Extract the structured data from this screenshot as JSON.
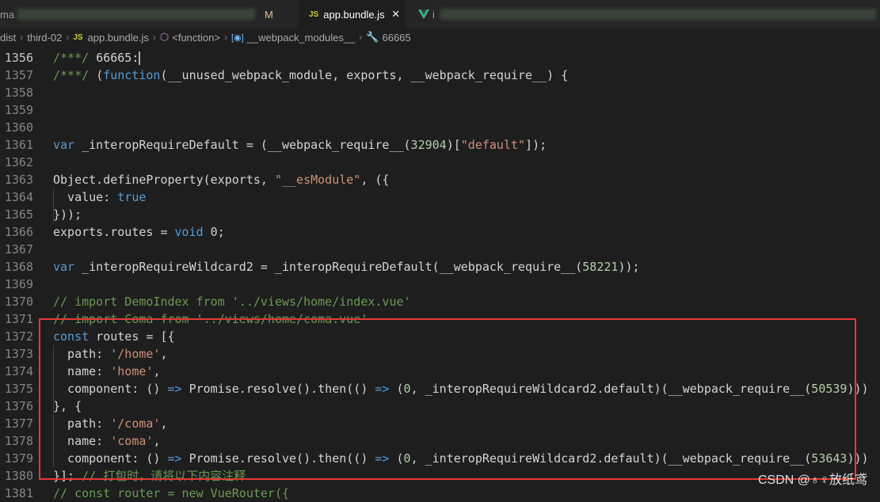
{
  "tabs": [
    {
      "label": "ma",
      "status": "M",
      "active": false
    },
    {
      "label": "app.bundle.js",
      "icon": "JS",
      "active": true,
      "close": "×"
    },
    {
      "label": "i",
      "icon": "vue-icon",
      "active": false
    }
  ],
  "breadcrumb": [
    "dist",
    "third-02",
    "app.bundle.js",
    "<function>",
    "__webpack_modules__",
    "66665"
  ],
  "lines": [
    {
      "n": "1356",
      "tokens": [
        {
          "t": "/***/ ",
          "c": "cm"
        },
        {
          "t": "66665:",
          "c": "pl"
        }
      ]
    },
    {
      "n": "1357",
      "tokens": [
        {
          "t": "/***/ ",
          "c": "cm"
        },
        {
          "t": "(",
          "c": "pl"
        },
        {
          "t": "function",
          "c": "kw"
        },
        {
          "t": "(__unused_webpack_module, exports, __webpack_require__) {",
          "c": "pl"
        }
      ]
    },
    {
      "n": "1358",
      "tokens": []
    },
    {
      "n": "1359",
      "tokens": []
    },
    {
      "n": "1360",
      "tokens": []
    },
    {
      "n": "1361",
      "tokens": [
        {
          "t": "var",
          "c": "kw"
        },
        {
          "t": " _interopRequireDefault = (__webpack_require__(",
          "c": "pl"
        },
        {
          "t": "32904",
          "c": "num"
        },
        {
          "t": ")[",
          "c": "pl"
        },
        {
          "t": "\"default\"",
          "c": "str"
        },
        {
          "t": "]);",
          "c": "pl"
        }
      ]
    },
    {
      "n": "1362",
      "tokens": []
    },
    {
      "n": "1363",
      "tokens": [
        {
          "t": "Object.defineProperty(exports, ",
          "c": "pl"
        },
        {
          "t": "\"__esModule\"",
          "c": "str"
        },
        {
          "t": ", ({",
          "c": "pl"
        }
      ]
    },
    {
      "n": "1364",
      "tokens": [
        {
          "t": "  value: ",
          "c": "pl"
        },
        {
          "t": "true",
          "c": "kw"
        }
      ]
    },
    {
      "n": "1365",
      "tokens": [
        {
          "t": "}));",
          "c": "pl"
        }
      ]
    },
    {
      "n": "1366",
      "tokens": [
        {
          "t": "exports.routes = ",
          "c": "pl"
        },
        {
          "t": "void",
          "c": "kw"
        },
        {
          "t": " 0;",
          "c": "pl"
        }
      ]
    },
    {
      "n": "1367",
      "tokens": []
    },
    {
      "n": "1368",
      "tokens": [
        {
          "t": "var",
          "c": "kw"
        },
        {
          "t": " _interopRequireWildcard2 = _interopRequireDefault(__webpack_require__(",
          "c": "pl"
        },
        {
          "t": "58221",
          "c": "num"
        },
        {
          "t": "));",
          "c": "pl"
        }
      ]
    },
    {
      "n": "1369",
      "tokens": []
    },
    {
      "n": "1370",
      "tokens": [
        {
          "t": "// import DemoIndex from '../views/home/index.vue'",
          "c": "cm"
        }
      ]
    },
    {
      "n": "1371",
      "tokens": [
        {
          "t": "// import Coma from '../views/home/coma.vue'",
          "c": "cm"
        }
      ]
    },
    {
      "n": "1372",
      "tokens": [
        {
          "t": "const",
          "c": "kw"
        },
        {
          "t": " routes = [{",
          "c": "pl"
        }
      ]
    },
    {
      "n": "1373",
      "tokens": [
        {
          "t": "  path: ",
          "c": "pl"
        },
        {
          "t": "'/home'",
          "c": "str"
        },
        {
          "t": ",",
          "c": "pl"
        }
      ]
    },
    {
      "n": "1374",
      "tokens": [
        {
          "t": "  name: ",
          "c": "pl"
        },
        {
          "t": "'home'",
          "c": "str"
        },
        {
          "t": ",",
          "c": "pl"
        }
      ]
    },
    {
      "n": "1375",
      "tokens": [
        {
          "t": "  component: () ",
          "c": "pl"
        },
        {
          "t": "=>",
          "c": "kw"
        },
        {
          "t": " Promise.resolve().then(() ",
          "c": "pl"
        },
        {
          "t": "=>",
          "c": "kw"
        },
        {
          "t": " (",
          "c": "pl"
        },
        {
          "t": "0",
          "c": "num"
        },
        {
          "t": ", _interopRequireWildcard2.default)(__webpack_require__(",
          "c": "pl"
        },
        {
          "t": "50539",
          "c": "num"
        },
        {
          "t": ")))",
          "c": "pl"
        }
      ]
    },
    {
      "n": "1376",
      "tokens": [
        {
          "t": "}, {",
          "c": "pl"
        }
      ]
    },
    {
      "n": "1377",
      "tokens": [
        {
          "t": "  path: ",
          "c": "pl"
        },
        {
          "t": "'/coma'",
          "c": "str"
        },
        {
          "t": ",",
          "c": "pl"
        }
      ]
    },
    {
      "n": "1378",
      "tokens": [
        {
          "t": "  name: ",
          "c": "pl"
        },
        {
          "t": "'coma'",
          "c": "str"
        },
        {
          "t": ",",
          "c": "pl"
        }
      ]
    },
    {
      "n": "1379",
      "tokens": [
        {
          "t": "  component: () ",
          "c": "pl"
        },
        {
          "t": "=>",
          "c": "kw"
        },
        {
          "t": " Promise.resolve().then(() ",
          "c": "pl"
        },
        {
          "t": "=>",
          "c": "kw"
        },
        {
          "t": " (",
          "c": "pl"
        },
        {
          "t": "0",
          "c": "num"
        },
        {
          "t": ", _interopRequireWildcard2.default)(__webpack_require__(",
          "c": "pl"
        },
        {
          "t": "53643",
          "c": "num"
        },
        {
          "t": ")))",
          "c": "pl"
        }
      ]
    },
    {
      "n": "1380",
      "tokens": [
        {
          "t": "}]; ",
          "c": "pl"
        },
        {
          "t": "// 打包时，请将以下内容注释",
          "c": "cm"
        }
      ]
    },
    {
      "n": "1381",
      "tokens": [
        {
          "t": "// const router = new VueRouter({",
          "c": "cm"
        }
      ]
    }
  ],
  "watermark": "CSDN @♁♀放纸鸢",
  "colors": {
    "background": "#1e1e1e",
    "keyword": "#569cd6",
    "string": "#ce9178",
    "comment": "#6a9955",
    "number": "#b5cea8",
    "highlight_border": "#e53935"
  }
}
